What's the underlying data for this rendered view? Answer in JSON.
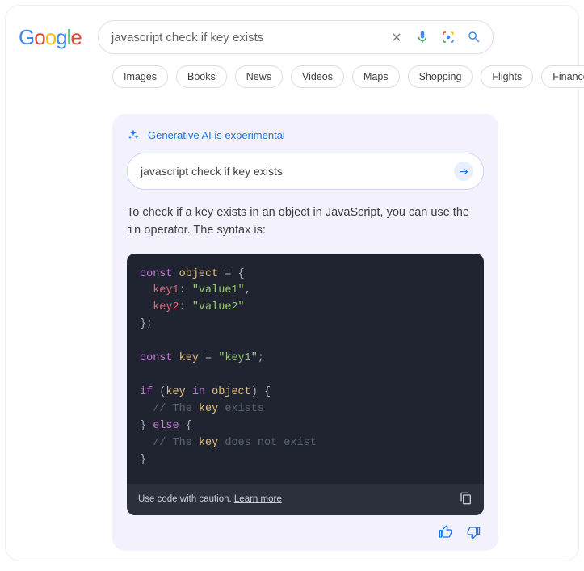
{
  "search": {
    "query": "javascript check if key exists"
  },
  "chips": [
    "Images",
    "Books",
    "News",
    "Videos",
    "Maps",
    "Shopping",
    "Flights",
    "Finance"
  ],
  "ai": {
    "badge": "Generative AI is experimental",
    "prompt": "javascript check if key exists",
    "explain_pre": "To check if a key exists in an object in JavaScript, you can use the ",
    "explain_code": "in",
    "explain_post": " operator.  The syntax is:",
    "code_raw": "const object = {\n  key1: \"value1\",\n  key2: \"value2\"\n};\n\nconst key = \"key1\";\n\nif (key in object) {\n  // The key exists\n} else {\n  // The key does not exist\n}",
    "caution": "Use code with caution.",
    "learn_more": "Learn more"
  }
}
